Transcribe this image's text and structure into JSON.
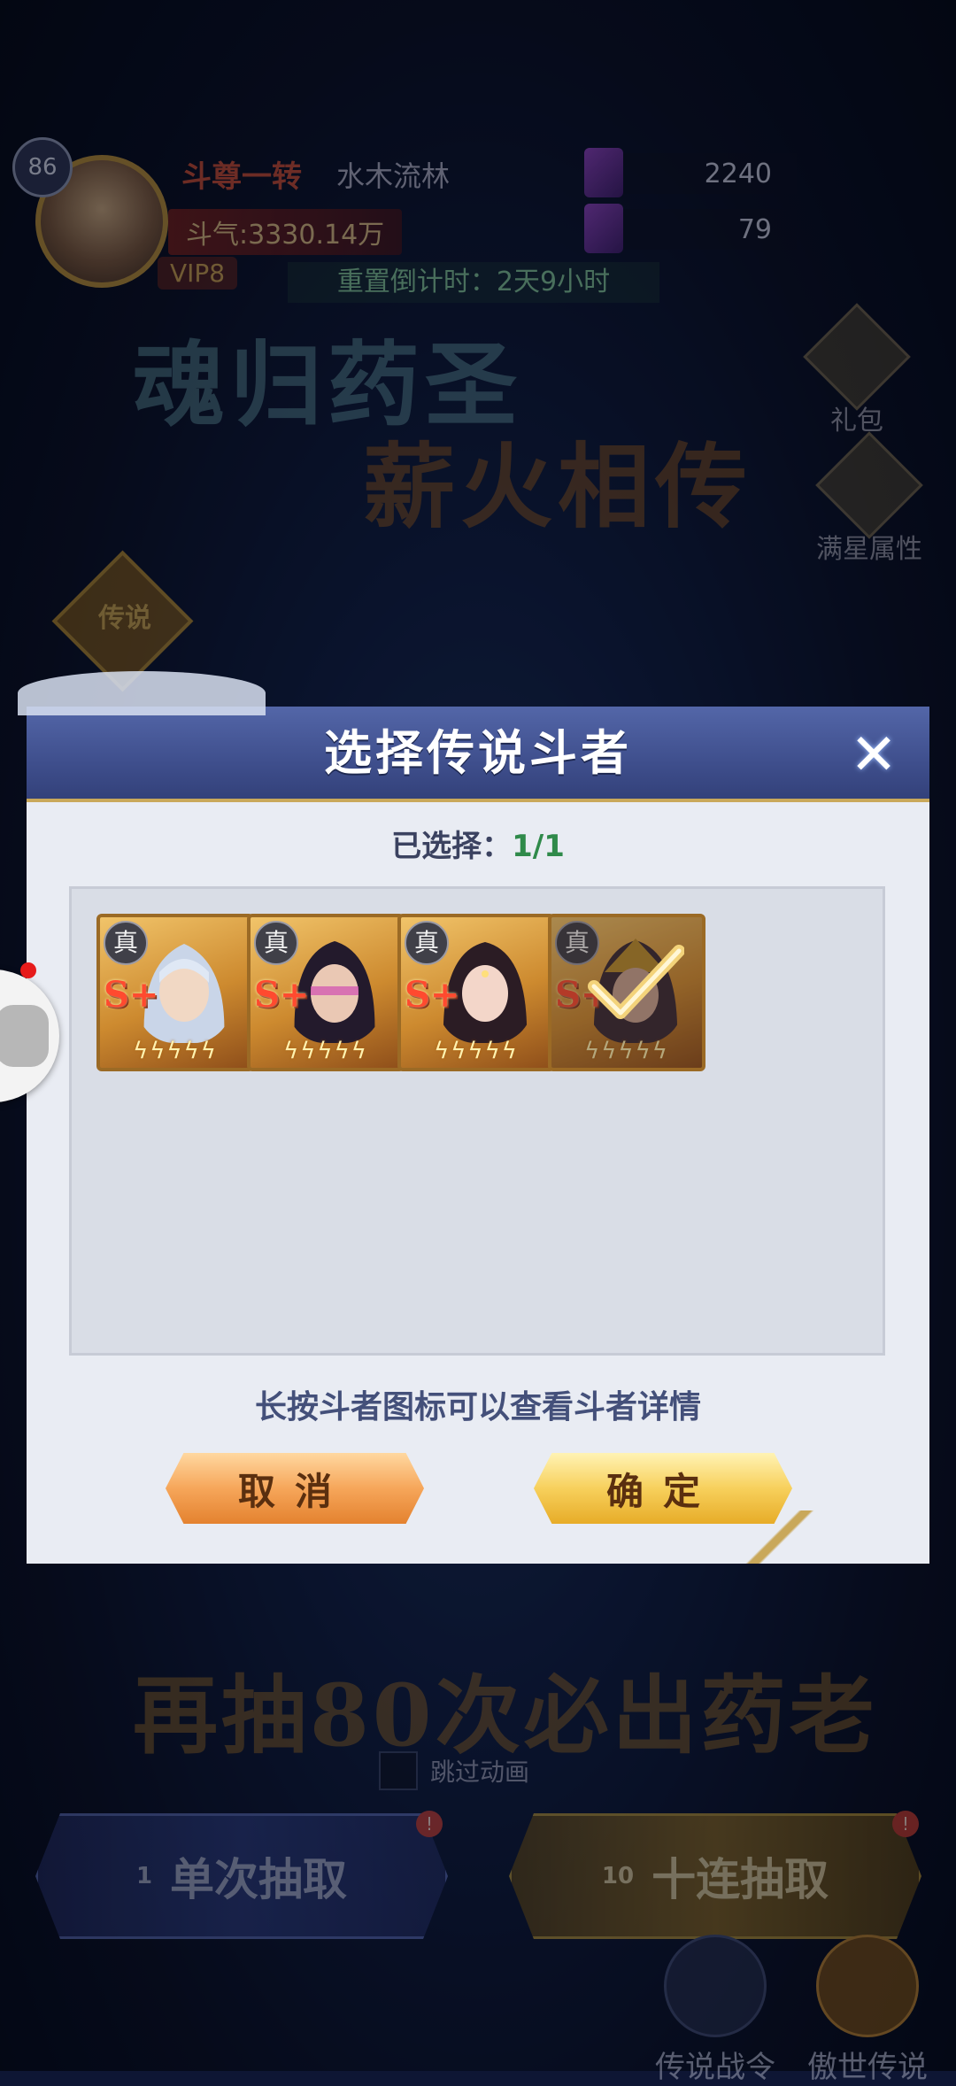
{
  "player": {
    "level": "86",
    "rank": "斗尊一转",
    "name": "水木流林",
    "power": "斗气:3330.14万",
    "vip": "VIP8"
  },
  "currency": [
    {
      "icon": "purple-crystal-icon",
      "value": "2240"
    },
    {
      "icon": "purple-ticket-icon",
      "value": "79"
    }
  ],
  "event": {
    "reset_timer": "重置倒计时：2天9小时",
    "title_line1": "魂归药圣",
    "title_line2": "薪火相传",
    "side_gift": "礼包",
    "side_star": "满星属性",
    "legend_tag": "传说",
    "pity_text": "再抽80次必出药老",
    "skip_label": "跳过动画"
  },
  "draw": {
    "single_label": "单次抽取",
    "single_cost": "1",
    "ten_label": "十连抽取",
    "ten_cost": "10"
  },
  "bottom_nav": [
    "传说战令",
    "傲世传说"
  ],
  "modal": {
    "title": "选择传说斗者",
    "close_icon": "close-icon",
    "selected_label": "已选择：",
    "selected_count": "1/1",
    "hint": "长按斗者图标可以查看斗者详情",
    "cancel": "取消",
    "confirm": "确定",
    "cards": [
      {
        "badge": "真",
        "grade": "S+",
        "stars": "ϟϟϟϟϟ",
        "selected": false,
        "accent": "#9fb4d6"
      },
      {
        "badge": "真",
        "grade": "S+",
        "stars": "ϟϟϟϟϟ",
        "selected": false,
        "accent": "#d04db0"
      },
      {
        "badge": "真",
        "grade": "S+",
        "stars": "ϟϟϟϟϟ",
        "selected": false,
        "accent": "#7a5a7e"
      },
      {
        "badge": "真",
        "grade": "S+",
        "stars": "ϟϟϟϟϟ",
        "selected": true,
        "accent": "#6c4b58"
      }
    ]
  }
}
